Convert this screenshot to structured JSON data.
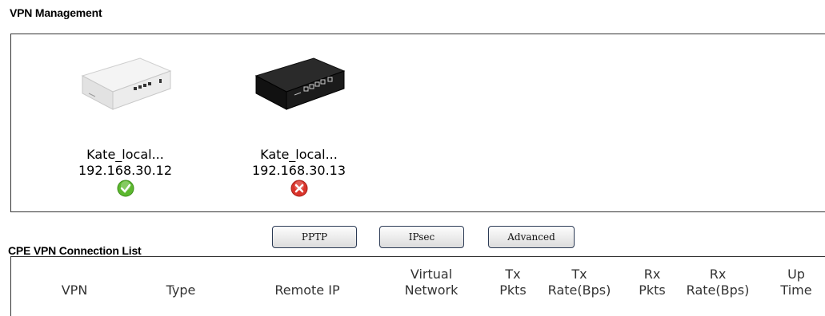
{
  "vpn_management": {
    "title": "VPN Management",
    "devices": [
      {
        "name": "Kate_local...",
        "ip": "192.168.30.12",
        "status": "connected",
        "status_icon": "green-check-icon",
        "status_color": "#5cb82e",
        "router_color": "#f2f2f2"
      },
      {
        "name": "Kate_local...",
        "ip": "192.168.30.13",
        "status": "disconnected",
        "status_icon": "red-x-icon",
        "status_color": "#d9342b",
        "router_color": "#1a1a1a"
      }
    ]
  },
  "buttons": {
    "pptp": "PPTP",
    "ipsec": "IPsec",
    "advanced": "Advanced"
  },
  "connection_list": {
    "title": "CPE VPN Connection List",
    "columns": [
      {
        "line1": "VPN",
        "line2": ""
      },
      {
        "line1": "Type",
        "line2": ""
      },
      {
        "line1": "Remote IP",
        "line2": ""
      },
      {
        "line1": "Virtual",
        "line2": "Network"
      },
      {
        "line1": "Tx",
        "line2": "Pkts"
      },
      {
        "line1": "Tx",
        "line2": "Rate(Bps)"
      },
      {
        "line1": "Rx",
        "line2": "Pkts"
      },
      {
        "line1": "Rx",
        "line2": "Rate(Bps)"
      },
      {
        "line1": "Up",
        "line2": "Time"
      }
    ]
  }
}
